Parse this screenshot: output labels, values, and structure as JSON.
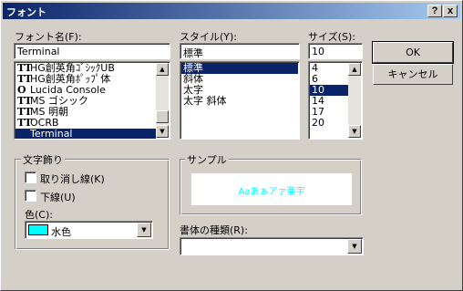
{
  "window": {
    "title": "フォント",
    "help_label": "?",
    "close_label": "x"
  },
  "font": {
    "label": "フォント名(F):",
    "value": "Terminal",
    "items": [
      {
        "icon": "TT",
        "name": "HG創英角ｺﾞｼｯｸUB"
      },
      {
        "icon": "TT",
        "name": "HG創英角ﾎﾟｯﾌﾟ体"
      },
      {
        "icon": "O",
        "name": "Lucida Console"
      },
      {
        "icon": "TT",
        "name": "MS ゴシック"
      },
      {
        "icon": "TT",
        "name": "MS 明朝"
      },
      {
        "icon": "TT",
        "name": "OCRB"
      },
      {
        "icon": "",
        "name": "Terminal"
      }
    ],
    "selected_index": 6,
    "scroll_up": "▲",
    "scroll_down": "▼"
  },
  "style": {
    "label": "スタイル(Y):",
    "value": "標準",
    "items": [
      "標準",
      "斜体",
      "太字",
      "太字 斜体"
    ],
    "selected_index": 0
  },
  "size": {
    "label": "サイズ(S):",
    "value": "10",
    "items": [
      "4",
      "6",
      "10",
      "14",
      "17",
      "20"
    ],
    "selected_index": 2,
    "scroll_up": "▲",
    "scroll_down": "▼"
  },
  "buttons": {
    "ok": "OK",
    "cancel": "キャンセル"
  },
  "effects": {
    "legend": "文字飾り",
    "strikeout": "取り消し線(K)",
    "underline": "下線(U)",
    "color_label": "色(C):",
    "color_value": "水色",
    "color_hex": "#00ffff",
    "combo_arrow": "▼"
  },
  "sample": {
    "legend": "サンプル",
    "text": "Aaあぁアァ亜宇",
    "text_color": "#00ffff"
  },
  "script": {
    "label": "書体の種類(R):",
    "value": "",
    "combo_arrow": "▼"
  }
}
